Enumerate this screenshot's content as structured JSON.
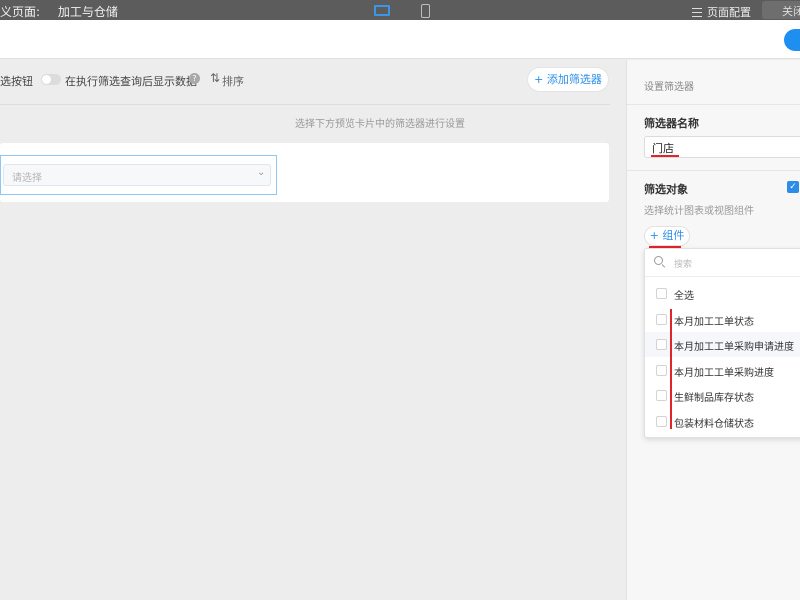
{
  "header": {
    "page_title": "义页面:",
    "page_name": "加工与仓储",
    "config_label": "页面配置",
    "close_label": "关闭"
  },
  "toolbar": {
    "filter_button_label": "选按钮",
    "toggle_label": "在执行筛选查询后显示数据",
    "help": "?",
    "sort_label": "排序",
    "add_filter_label": "+ 添加筛选器"
  },
  "main": {
    "hint": "选择下方预览卡片中的筛选器进行设置",
    "select_placeholder": "请选择"
  },
  "panel": {
    "title": "设置筛选器",
    "name_label": "筛选器名称",
    "name_value": "门店",
    "target_label": "筛选对象",
    "target_desc": "选择统计图表或视图组件",
    "component_button": "+ 组件"
  },
  "dropdown": {
    "search_placeholder": "搜索",
    "items": [
      {
        "label": "全选"
      },
      {
        "label": "本月加工工单状态"
      },
      {
        "label": "本月加工工单采购申请进度"
      },
      {
        "label": "本月加工工单采购进度"
      },
      {
        "label": "生鲜制品库存状态"
      },
      {
        "label": "包装材料仓储状态"
      }
    ]
  },
  "colors": {
    "accent": "#2c8ee8",
    "annotation_red": "#e0242b",
    "header_bg": "#5c5c5c"
  }
}
